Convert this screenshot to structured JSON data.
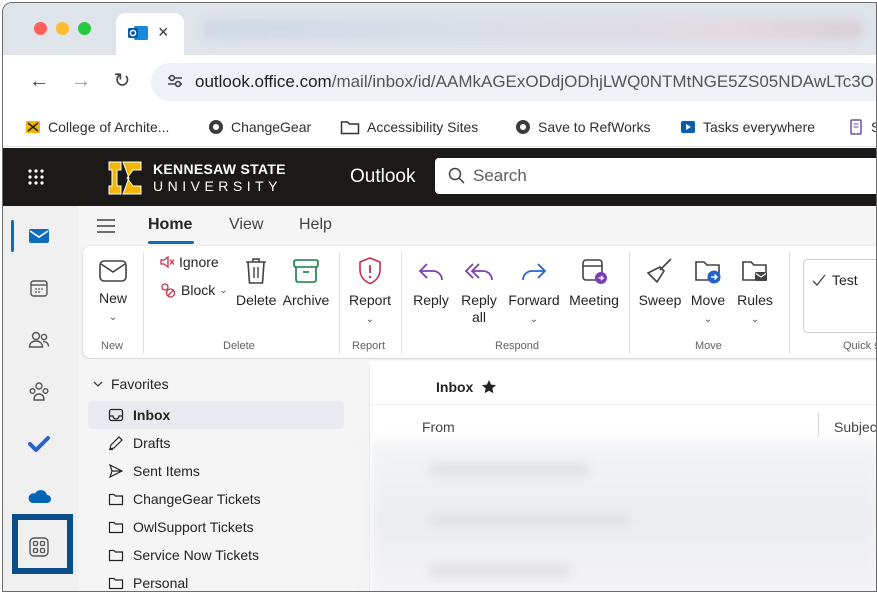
{
  "browser": {
    "tab_close": "×",
    "url_host": "outlook.office.com",
    "url_path": "/mail/inbox/id/AAMkAGExODdjODhjLWQ0NTMtNGE5ZS05NDAwLTc3O",
    "bookmarks": [
      {
        "label": "College of Archite...",
        "icon": "ksu-icon"
      },
      {
        "label": "ChangeGear",
        "icon": "globe-icon"
      },
      {
        "label": "Accessibility Sites",
        "icon": "folder-icon"
      },
      {
        "label": "Save to RefWorks",
        "icon": "globe-icon"
      },
      {
        "label": "Tasks everywhere",
        "icon": "video-icon"
      },
      {
        "label": "S",
        "icon": "doc-icon"
      }
    ]
  },
  "header": {
    "brand_line1": "KENNESAW STATE",
    "brand_line2": "UNIVERSITY",
    "app_title": "Outlook",
    "search_placeholder": "Search"
  },
  "ribbon_tabs": [
    "Home",
    "View",
    "Help"
  ],
  "ribbon": {
    "new": {
      "label": "New",
      "caret": "⌄"
    },
    "ignore": "Ignore",
    "block": "Block",
    "delete": "Delete",
    "archive": "Archive",
    "report": {
      "label": "Report",
      "caret": "⌄"
    },
    "reply": "Reply",
    "reply_all_1": "Reply",
    "reply_all_2": "all",
    "forward": {
      "label": "Forward",
      "caret": "⌄"
    },
    "meeting": "Meeting",
    "sweep": "Sweep",
    "move": {
      "label": "Move",
      "caret": "⌄"
    },
    "rules": {
      "label": "Rules",
      "caret": "⌄"
    },
    "quick_step": "Test",
    "groups": [
      "New",
      "Delete",
      "Report",
      "Respond",
      "Move",
      "Quick st"
    ]
  },
  "folders": {
    "favorites_label": "Favorites",
    "items": [
      "Inbox",
      "Drafts",
      "Sent Items",
      "ChangeGear Tickets",
      "OwlSupport Tickets",
      "Service Now Tickets",
      "Personal"
    ]
  },
  "message_list": {
    "title": "Inbox",
    "col_from": "From",
    "col_subject": "Subject"
  },
  "colors": {
    "accent": "#0f6cbd",
    "header_bg": "#1b1a19",
    "highlight_box": "#0c4d8c"
  }
}
